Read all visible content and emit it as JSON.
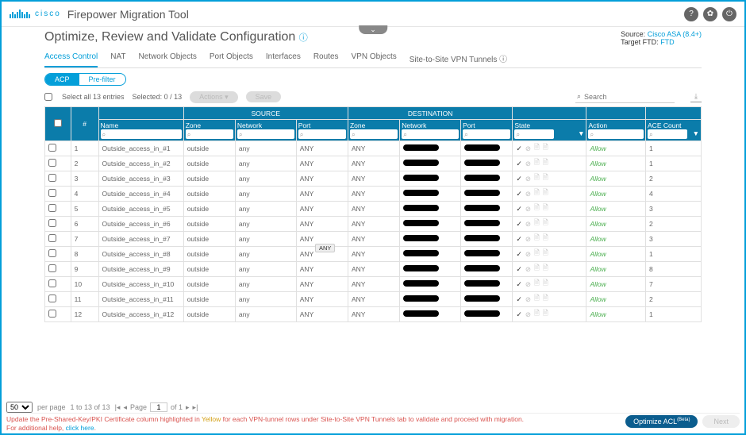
{
  "app": {
    "brand": "cisco",
    "title": "Firepower Migration Tool"
  },
  "page": {
    "title": "Optimize, Review and Validate Configuration"
  },
  "meta": {
    "source_label": "Source:",
    "source_value": "Cisco ASA (8.4+)",
    "target_label": "Target FTD:",
    "target_value": "FTD"
  },
  "tabs": [
    "Access Control",
    "NAT",
    "Network Objects",
    "Port Objects",
    "Interfaces",
    "Routes",
    "VPN Objects",
    "Site-to-Site VPN Tunnels"
  ],
  "active_tab": 0,
  "subtabs": {
    "acp": "ACP",
    "prefilter": "Pre-filter"
  },
  "toolbar": {
    "select_all": "Select all 13 entries",
    "selected": "Selected: 0 / 13",
    "actions": "Actions",
    "save": "Save",
    "search_placeholder": "Search"
  },
  "table": {
    "group_source": "SOURCE",
    "group_dest": "DESTINATION",
    "headers": {
      "num": "#",
      "name": "Name",
      "zone": "Zone",
      "network": "Network",
      "port": "Port",
      "state": "State",
      "action": "Action",
      "ace": "ACE Count"
    },
    "rows": [
      {
        "n": "1",
        "name": "Outside_access_in_#1",
        "sz": "outside",
        "snw": "any",
        "sp": "ANY",
        "dz": "ANY",
        "action": "Allow",
        "ace": "1"
      },
      {
        "n": "2",
        "name": "Outside_access_in_#2",
        "sz": "outside",
        "snw": "any",
        "sp": "ANY",
        "dz": "ANY",
        "action": "Allow",
        "ace": "1"
      },
      {
        "n": "3",
        "name": "Outside_access_in_#3",
        "sz": "outside",
        "snw": "any",
        "sp": "ANY",
        "dz": "ANY",
        "action": "Allow",
        "ace": "2"
      },
      {
        "n": "4",
        "name": "Outside_access_in_#4",
        "sz": "outside",
        "snw": "any",
        "sp": "ANY",
        "dz": "ANY",
        "action": "Allow",
        "ace": "4"
      },
      {
        "n": "5",
        "name": "Outside_access_in_#5",
        "sz": "outside",
        "snw": "any",
        "sp": "ANY",
        "dz": "ANY",
        "action": "Allow",
        "ace": "3"
      },
      {
        "n": "6",
        "name": "Outside_access_in_#6",
        "sz": "outside",
        "snw": "any",
        "sp": "ANY",
        "dz": "ANY",
        "action": "Allow",
        "ace": "2"
      },
      {
        "n": "7",
        "name": "Outside_access_in_#7",
        "sz": "outside",
        "snw": "any",
        "sp": "ANY",
        "dz": "ANY",
        "action": "Allow",
        "ace": "3"
      },
      {
        "n": "8",
        "name": "Outside_access_in_#8",
        "sz": "outside",
        "snw": "any",
        "sp": "ANY",
        "dz": "ANY",
        "action": "Allow",
        "ace": "1"
      },
      {
        "n": "9",
        "name": "Outside_access_in_#9",
        "sz": "outside",
        "snw": "any",
        "sp": "ANY",
        "dz": "ANY",
        "action": "Allow",
        "ace": "8"
      },
      {
        "n": "10",
        "name": "Outside_access_in_#10",
        "sz": "outside",
        "snw": "any",
        "sp": "ANY",
        "dz": "ANY",
        "action": "Allow",
        "ace": "7"
      },
      {
        "n": "11",
        "name": "Outside_access_in_#11",
        "sz": "outside",
        "snw": "any",
        "sp": "ANY",
        "dz": "ANY",
        "action": "Allow",
        "ace": "2"
      },
      {
        "n": "12",
        "name": "Outside_access_in_#12",
        "sz": "outside",
        "snw": "any",
        "sp": "ANY",
        "dz": "ANY",
        "action": "Allow",
        "ace": "1"
      }
    ]
  },
  "pager": {
    "per_page_options": [
      "50"
    ],
    "per_page_label": "per page",
    "range": "1 to 13 of 13",
    "page_label": "Page",
    "page": "1",
    "of_label": "of 1"
  },
  "footer_msg": {
    "line1a": "Update the Pre-Shared-Key/PKI Certificate column highlighted in ",
    "line1_yellow": "Yellow",
    "line1b": " for each VPN-tunnel rows under Site-to-Site VPN Tunnels tab to validate and proceed with migration.",
    "line2a": "For additional help, ",
    "line2_link": "click here",
    "line2b": "."
  },
  "buttons": {
    "optimize": "Optimize ACL",
    "optimize_sup": "(Beta)",
    "next": "Next"
  },
  "glyphs": {
    "search": "⌕",
    "filter": "▼",
    "check": "✓",
    "down": "⌄",
    "first": "|◂",
    "prev": "◂",
    "next": "▸",
    "last": "▸|"
  }
}
